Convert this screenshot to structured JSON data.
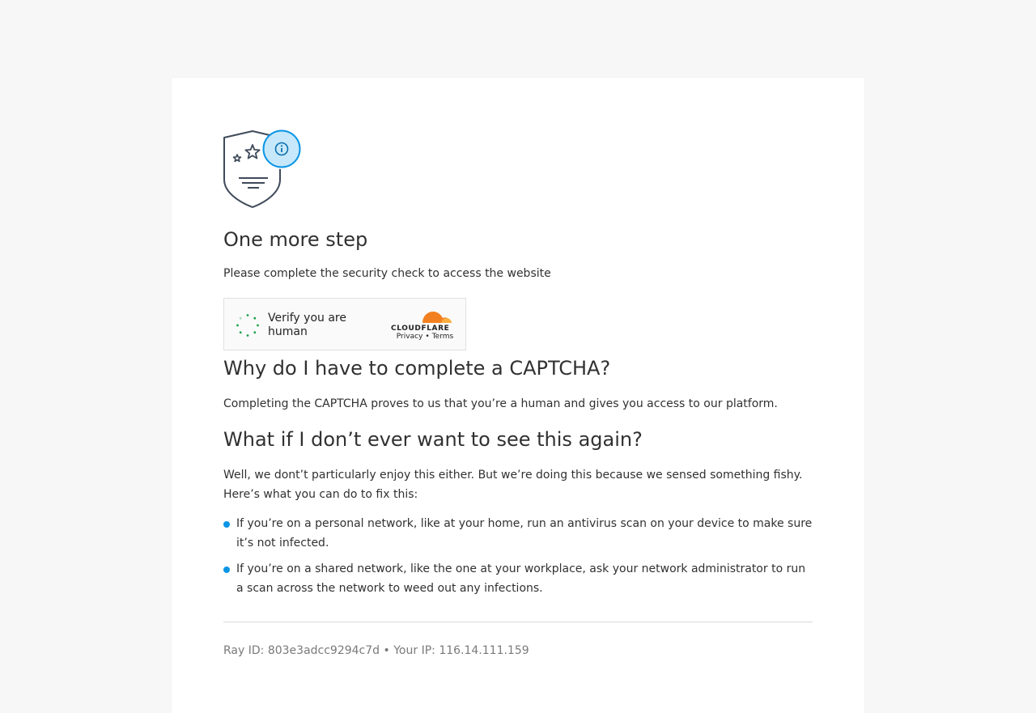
{
  "page": {
    "title": "One more step",
    "subtitle": "Please complete the security check to access the website"
  },
  "widget": {
    "label": "Verify you are human",
    "privacy": "Privacy",
    "separator": "•",
    "terms": "Terms",
    "brand_colors": {
      "orange": "#f38020",
      "light_orange": "#faae40",
      "spinner": "#1aa34a"
    }
  },
  "sections": {
    "why": {
      "heading": "Why do I have to complete a CAPTCHA?",
      "body": "Completing the CAPTCHA proves to us that you’re a human and gives you access to our platform."
    },
    "whatif": {
      "heading": "What if I don’t ever want to see this again?",
      "body": "Well, we dont’t particularly enjoy this either. But we’re doing this because we sensed something fishy. Here’s what you can do to fix this:",
      "items": [
        "If you’re on a personal network, like at your home, run an antivirus scan on your device to make sure it’s not infected.",
        "If you’re on a shared network, like the one at your workplace, ask your network administrator to run a scan across the network to weed out any infections."
      ]
    }
  },
  "footer": {
    "ray_label": "Ray ID:",
    "ray_id": "803e3adcc9294c7d",
    "bullet": "•",
    "ip_label": "Your IP:",
    "ip": "116.14.111.159"
  },
  "icons": {
    "shield": "shield-icon",
    "info": "info-icon",
    "star": "star-icon",
    "spinner": "loading-spinner-icon",
    "cloudflare": "cloudflare-logo"
  },
  "colors": {
    "accent": "#0a95e6",
    "text": "#313131",
    "muted": "#7a7a7a",
    "background": "#f7f7f7"
  }
}
